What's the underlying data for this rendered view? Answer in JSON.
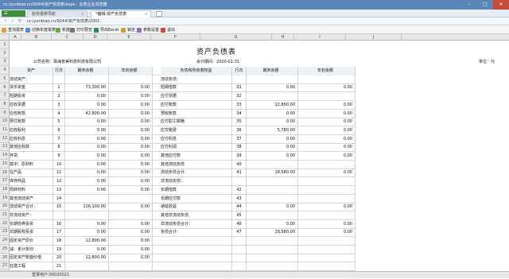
{
  "window": {
    "title": "cc.iyunbiao.cn/9244/资产负债表/aspx - 云表企业浏览器"
  },
  "tabs": [
    {
      "label": "财务报表导航"
    },
    {
      "label": "*编辑:资产负债表"
    }
  ],
  "address": {
    "url": "cc.iyunbiao.cn/9244/资产负债表/2001"
  },
  "toolbar": {
    "items": [
      "查询报表",
      "切换年度报表",
      "新建",
      "打印预览",
      "导出Excel",
      "锁定",
      "参数设置",
      "退出"
    ]
  },
  "columns": [
    "A",
    "B",
    "C",
    "D",
    "E",
    "F",
    "G",
    "H",
    "I",
    "J"
  ],
  "rows": [
    "1",
    "2",
    "3",
    "4",
    "5",
    "6",
    "7",
    "8",
    "9",
    "10",
    "11",
    "12",
    "13",
    "14",
    "15",
    "16",
    "17",
    "18",
    "19",
    "20",
    "21",
    "22",
    "23",
    "24",
    "25",
    "26",
    "27"
  ],
  "report": {
    "title": "资产负债表",
    "company_label": "公司名称：",
    "company": "珠海普美科技科技有限公司",
    "period_label": "会计期间：",
    "period": "2020-01-31",
    "unit_label": "单位：元"
  },
  "table": {
    "headers_left": [
      "资产",
      "行次",
      "期末余额",
      "年初余额"
    ],
    "headers_right": [
      "负债和所有者权益",
      "行次",
      "期末余额",
      "年初余额"
    ],
    "left_rows": [
      {
        "name": "流动资产：",
        "line": "",
        "end": "",
        "begin": ""
      },
      {
        "name": "货币资金",
        "line": "1",
        "end": "73,300.00",
        "begin": "0.00"
      },
      {
        "name": "短期投资",
        "line": "2",
        "end": "0.00",
        "begin": "0.00"
      },
      {
        "name": "应收票据",
        "line": "3",
        "end": "0.00",
        "begin": "0.00"
      },
      {
        "name": "应收账款",
        "line": "4",
        "end": "42,800.00",
        "begin": "0.00"
      },
      {
        "name": "预付账款",
        "line": "5",
        "end": "0.00",
        "begin": "0.00"
      },
      {
        "name": "应收股利",
        "line": "6",
        "end": "0.00",
        "begin": "0.00"
      },
      {
        "name": "应收利息",
        "line": "7",
        "end": "0.00",
        "begin": "0.00"
      },
      {
        "name": "其他应收款",
        "line": "8",
        "end": "0.00",
        "begin": "0.00"
      },
      {
        "name": "存货",
        "line": "9",
        "end": "0.00",
        "begin": "0.00"
      },
      {
        "name": "其中：原材料",
        "line": "10",
        "end": "0.00",
        "begin": "0.00"
      },
      {
        "name": "在产品",
        "line": "11",
        "end": "0.00",
        "begin": "0.00"
      },
      {
        "name": "库存商品",
        "line": "12",
        "end": "0.00",
        "begin": "0.00"
      },
      {
        "name": "周转材料",
        "line": "13",
        "end": "0.00",
        "begin": "0.00"
      },
      {
        "name": "其他流动资产",
        "line": "14",
        "end": "",
        "begin": ""
      },
      {
        "name": "流动资产合计：",
        "line": "15",
        "end": "116,100.00",
        "begin": "0.00"
      },
      {
        "name": "非流动资产：",
        "line": "",
        "end": "",
        "begin": ""
      },
      {
        "name": "长期债券投资",
        "line": "16",
        "end": "0.00",
        "begin": "0.00"
      },
      {
        "name": "长期股权投资",
        "line": "17",
        "end": "0.00",
        "begin": "0.00"
      },
      {
        "name": "固定资产原价",
        "line": "18",
        "end": "12,800.00",
        "begin": "0.00"
      },
      {
        "name": "减：累计折旧",
        "line": "19",
        "end": "0.00",
        "begin": "0.00"
      },
      {
        "name": "固定资产账面价值",
        "line": "20",
        "end": "12,800.00",
        "begin": "0.00"
      },
      {
        "name": "在建工程",
        "line": "21",
        "end": "",
        "begin": ""
      },
      {
        "name": "工程物资",
        "line": "22",
        "end": "",
        "begin": ""
      },
      {
        "name": "固定资产清理",
        "line": "23",
        "end": "",
        "begin": ""
      }
    ],
    "right_rows": [
      {
        "name": "流动负债：",
        "line": "",
        "end": "",
        "begin": ""
      },
      {
        "name": "短期借款",
        "line": "31",
        "end": "0.00",
        "begin": "0.00"
      },
      {
        "name": "应付票据",
        "line": "32",
        "end": "",
        "begin": ""
      },
      {
        "name": "应付账款",
        "line": "33",
        "end": "12,800.00",
        "begin": "0.00"
      },
      {
        "name": "预收账款",
        "line": "34",
        "end": "0.00",
        "begin": "0.00"
      },
      {
        "name": "应付职工薪酬",
        "line": "35",
        "end": "0.00",
        "begin": "0.00"
      },
      {
        "name": "应交税费",
        "line": "36",
        "end": "5,780.00",
        "begin": "0.00"
      },
      {
        "name": "应付利息",
        "line": "37",
        "end": "0.00",
        "begin": "0.00"
      },
      {
        "name": "应付利润",
        "line": "38",
        "end": "0.00",
        "begin": "0.00"
      },
      {
        "name": "其他应付款",
        "line": "39",
        "end": "0.00",
        "begin": "0.00"
      },
      {
        "name": "其他流动负债",
        "line": "40",
        "end": "",
        "begin": ""
      },
      {
        "name": "流动负债合计：",
        "line": "41",
        "end": "18,580.00",
        "begin": "0.00"
      },
      {
        "name": "非流动负债：",
        "line": "",
        "end": "",
        "begin": ""
      },
      {
        "name": "长期借款",
        "line": "42",
        "end": "",
        "begin": ""
      },
      {
        "name": "长期应付款",
        "line": "43",
        "end": "",
        "begin": ""
      },
      {
        "name": "递延收益",
        "line": "44",
        "end": "0.00",
        "begin": "0.00"
      },
      {
        "name": "其他非流动负债",
        "line": "45",
        "end": "",
        "begin": ""
      },
      {
        "name": "非流动负债合计：",
        "line": "46",
        "end": "0.00",
        "begin": "0.00"
      },
      {
        "name": "负债合计：",
        "line": "47",
        "end": "18,580.00",
        "begin": "0.00"
      },
      {
        "name": "",
        "line": "",
        "end": "",
        "begin": ""
      },
      {
        "name": "",
        "line": "",
        "end": "",
        "begin": ""
      },
      {
        "name": "",
        "line": "",
        "end": "",
        "begin": ""
      },
      {
        "name": "",
        "line": "",
        "end": "",
        "begin": ""
      },
      {
        "name": "",
        "line": "",
        "end": "",
        "begin": ""
      },
      {
        "name": "",
        "line": "",
        "end": "",
        "begin": ""
      }
    ]
  },
  "status": {
    "text": "登录用户:00020021"
  },
  "colors": {
    "titlebar": "#5b86b8",
    "app_button": "#3f8f3a",
    "close": "#c84a3d"
  }
}
